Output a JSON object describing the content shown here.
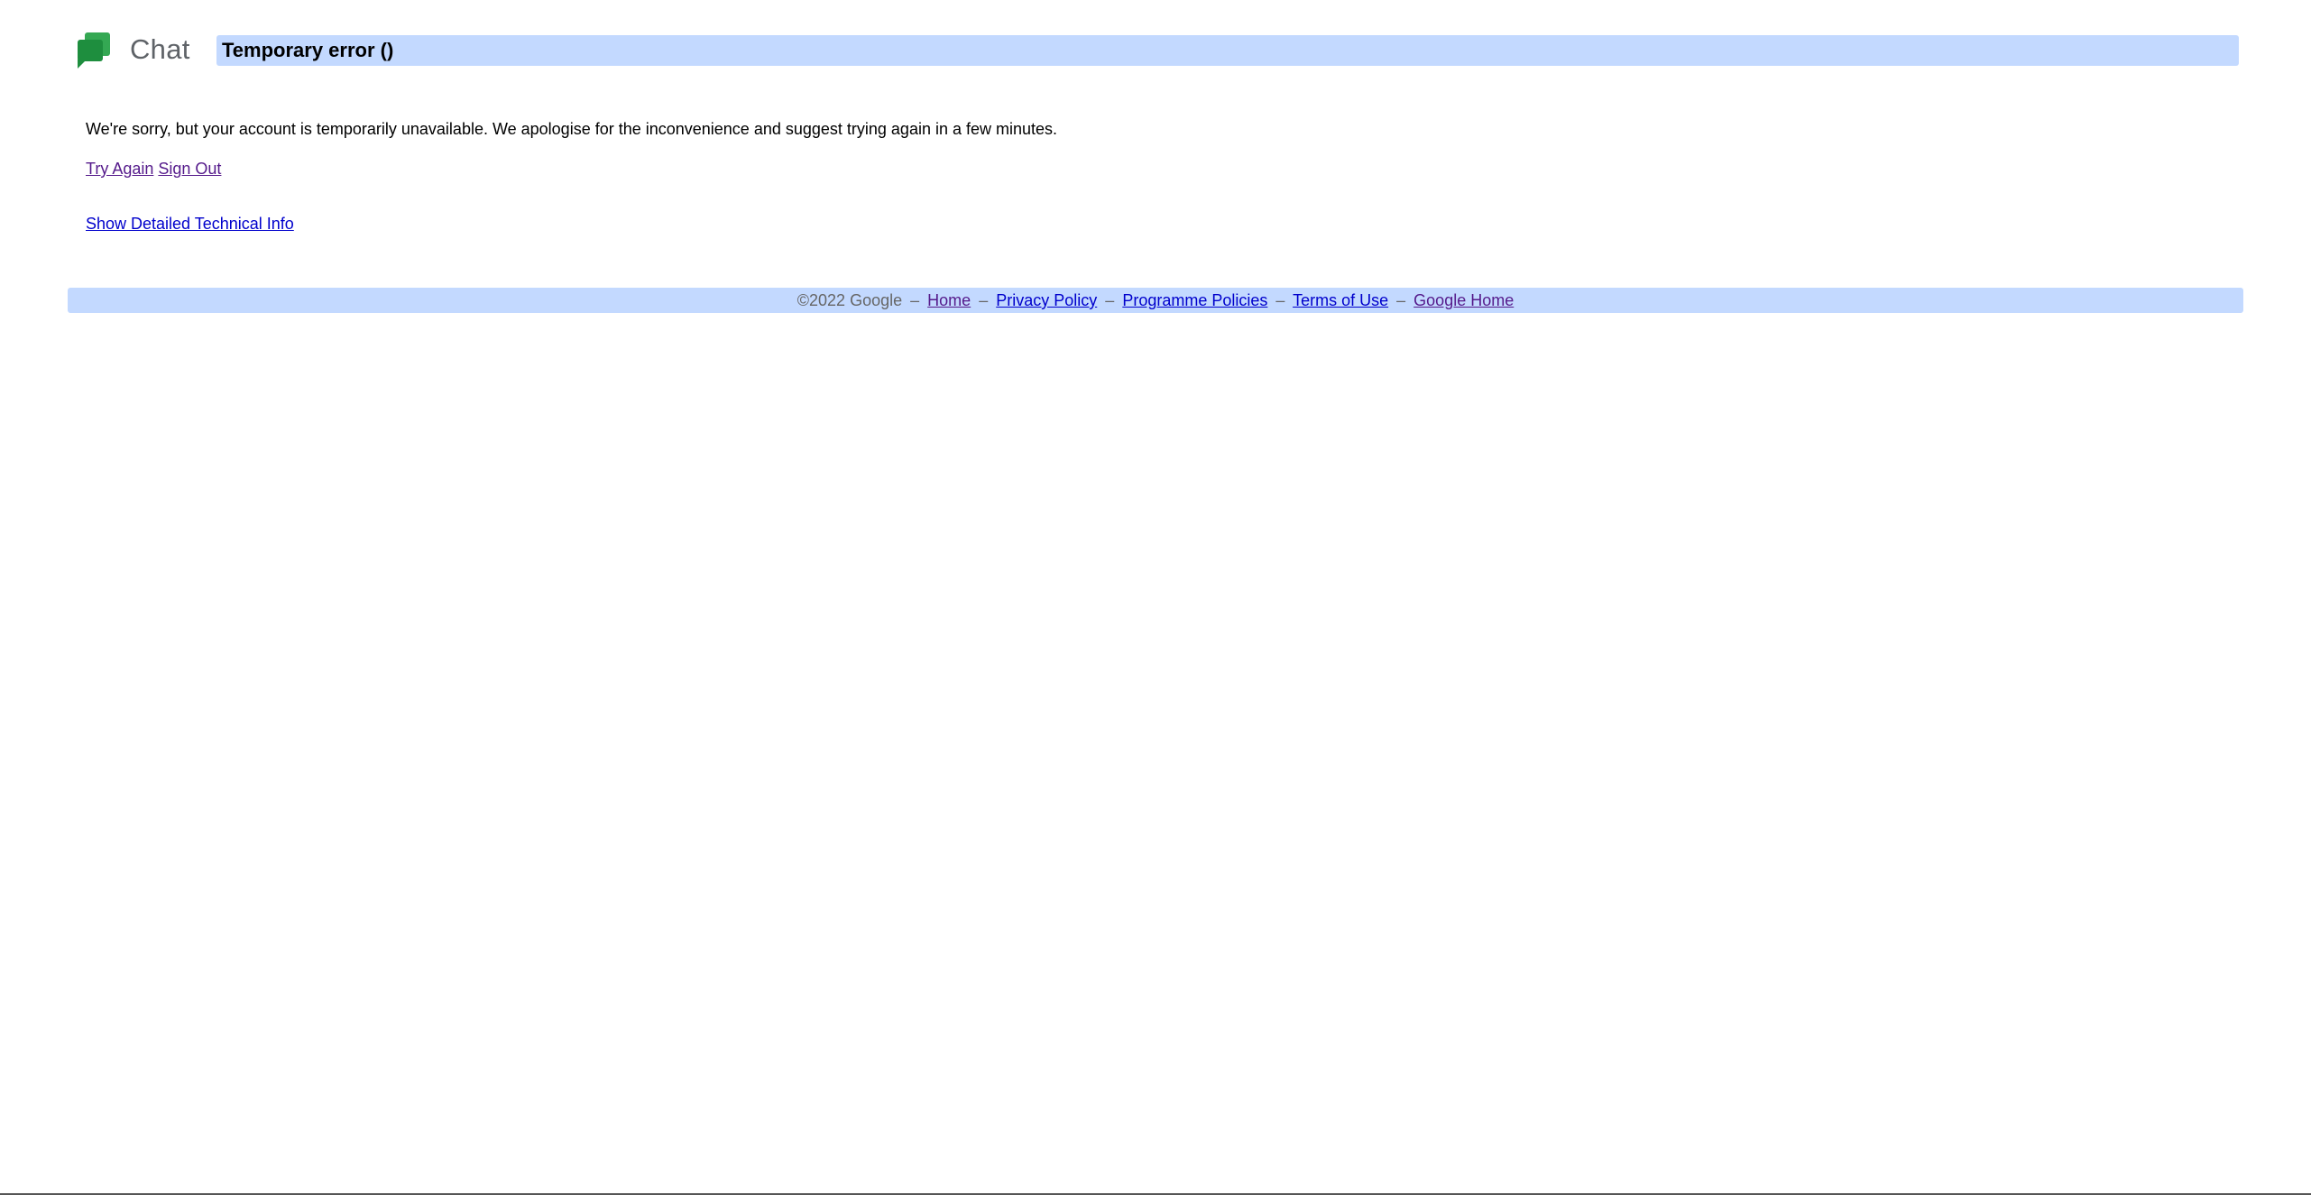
{
  "header": {
    "logo_text": "Chat",
    "title": "Temporary error ()"
  },
  "content": {
    "message": "We're sorry, but your account is temporarily unavailable. We apologise for the inconvenience and suggest trying again in a few minutes.",
    "try_again": "Try Again",
    "sign_out": "Sign Out",
    "tech_info": "Show Detailed Technical Info"
  },
  "footer": {
    "copyright": "©2022 Google",
    "separator": "–",
    "links": {
      "home": "Home",
      "privacy": "Privacy Policy",
      "programme": "Programme Policies",
      "terms": "Terms of Use",
      "google_home": "Google Home"
    }
  },
  "colors": {
    "bar_background": "#c3d9ff",
    "visited_link": "#551a8b",
    "unvisited_link": "#0000cc",
    "logo_green": "#34a853"
  }
}
